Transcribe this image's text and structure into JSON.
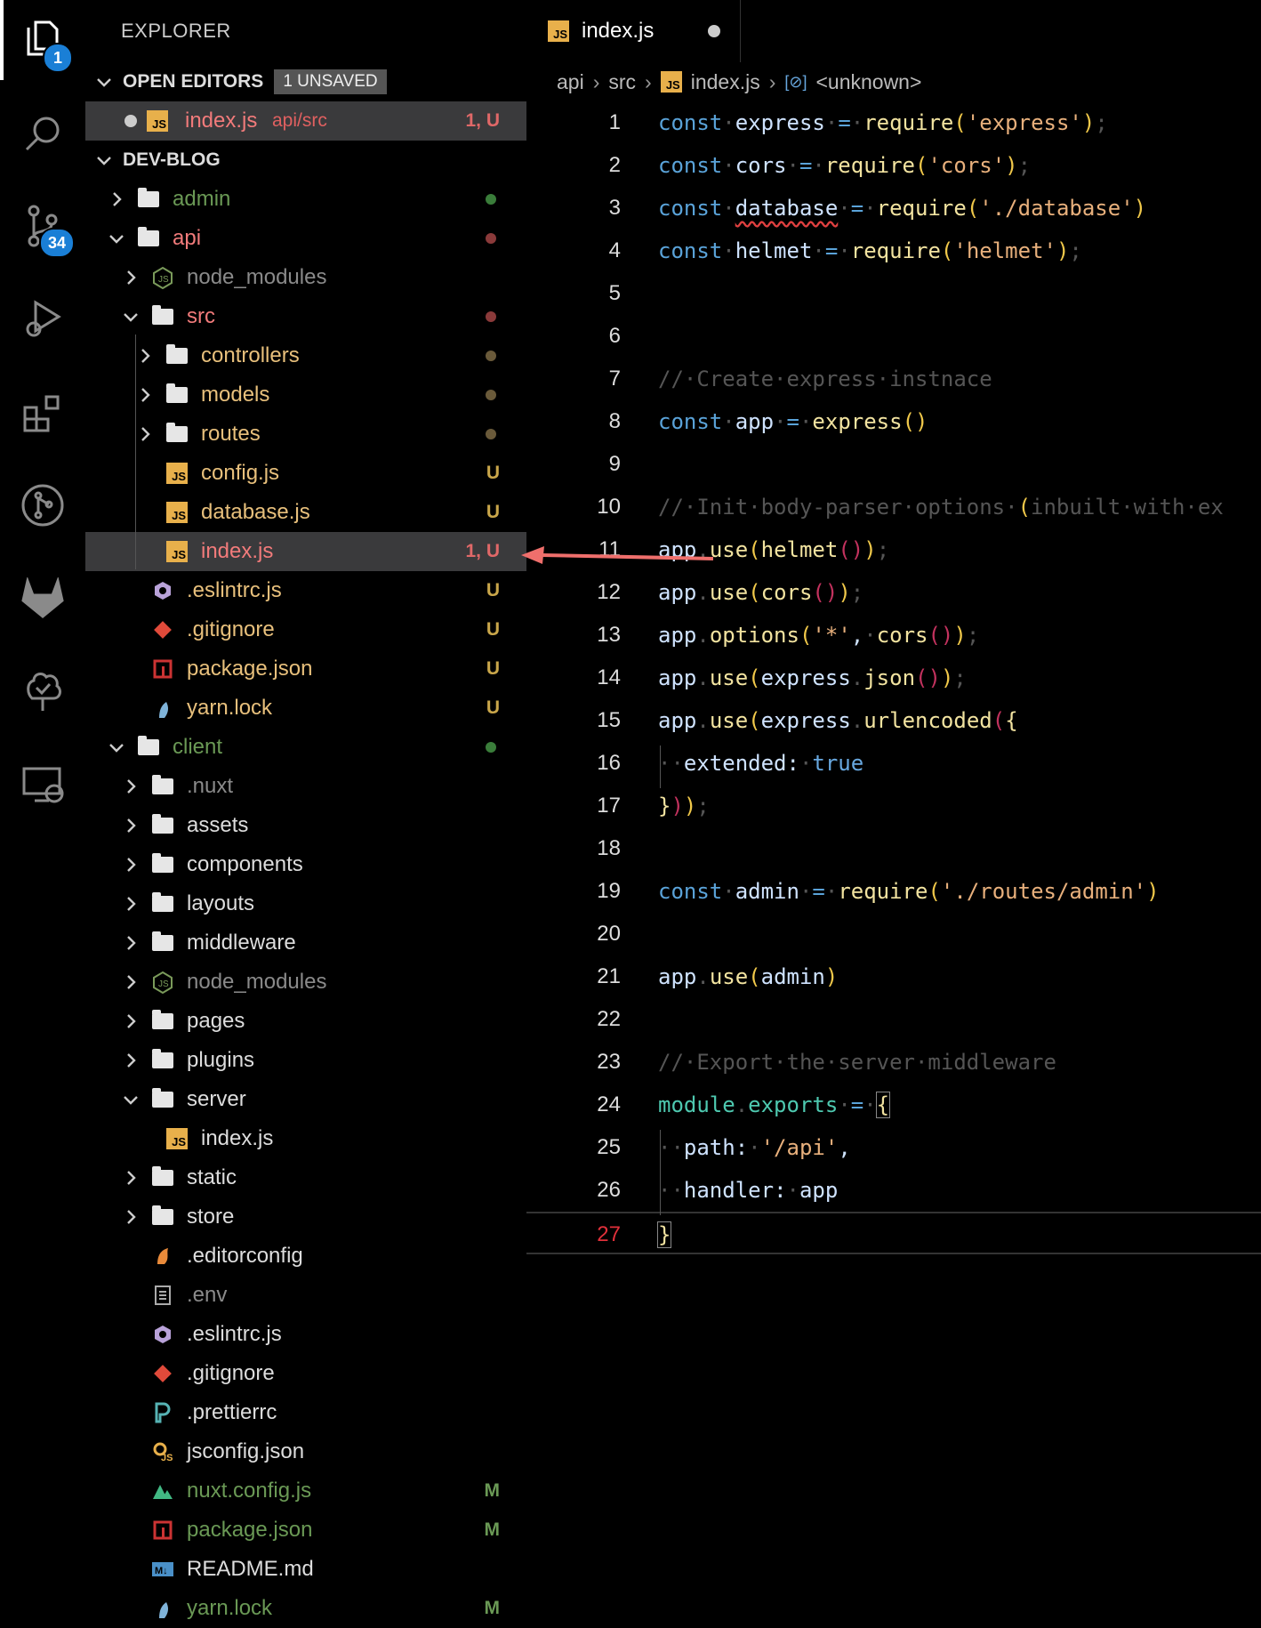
{
  "activity_bar": {
    "explorer_badge": "1",
    "scm_badge": "34",
    "items": [
      "files-icon",
      "search-icon",
      "source-control-icon",
      "run-debug-icon",
      "extensions-icon",
      "git-graph-icon",
      "gitlab-icon",
      "test-icon",
      "remote-explorer-icon"
    ]
  },
  "sidebar": {
    "title": "EXPLORER",
    "open_editors": {
      "label": "OPEN EDITORS",
      "unsaved": "1 UNSAVED",
      "items": [
        {
          "name": "index.js",
          "path": "api/src",
          "status": "1, U"
        }
      ]
    },
    "project": {
      "label": "DEV-BLOG",
      "rows": [
        {
          "label": "admin",
          "status": "",
          "dot": "#3a7d3a"
        },
        {
          "label": "api",
          "status": "",
          "dot": "#8a3a3a"
        },
        {
          "label": "node_modules",
          "status": "",
          "dot": ""
        },
        {
          "label": "src",
          "status": "",
          "dot": "#8a3a3a"
        },
        {
          "label": "controllers",
          "status": "",
          "dot": "#6a5a3a"
        },
        {
          "label": "models",
          "status": "",
          "dot": "#6a5a3a"
        },
        {
          "label": "routes",
          "status": "",
          "dot": "#6a5a3a"
        },
        {
          "label": "config.js",
          "status": "U",
          "dot": ""
        },
        {
          "label": "database.js",
          "status": "U",
          "dot": ""
        },
        {
          "label": "index.js",
          "status": "1, U",
          "dot": ""
        },
        {
          "label": ".eslintrc.js",
          "status": "U",
          "dot": ""
        },
        {
          "label": ".gitignore",
          "status": "U",
          "dot": ""
        },
        {
          "label": "package.json",
          "status": "U",
          "dot": ""
        },
        {
          "label": "yarn.lock",
          "status": "U",
          "dot": ""
        },
        {
          "label": "client",
          "status": "",
          "dot": "#3a7d3a"
        },
        {
          "label": ".nuxt",
          "status": "",
          "dot": ""
        },
        {
          "label": "assets",
          "status": "",
          "dot": ""
        },
        {
          "label": "components",
          "status": "",
          "dot": ""
        },
        {
          "label": "layouts",
          "status": "",
          "dot": ""
        },
        {
          "label": "middleware",
          "status": "",
          "dot": ""
        },
        {
          "label": "node_modules",
          "status": "",
          "dot": ""
        },
        {
          "label": "pages",
          "status": "",
          "dot": ""
        },
        {
          "label": "plugins",
          "status": "",
          "dot": ""
        },
        {
          "label": "server",
          "status": "",
          "dot": ""
        },
        {
          "label": "index.js",
          "status": "",
          "dot": ""
        },
        {
          "label": "static",
          "status": "",
          "dot": ""
        },
        {
          "label": "store",
          "status": "",
          "dot": ""
        },
        {
          "label": ".editorconfig",
          "status": "",
          "dot": ""
        },
        {
          "label": ".env",
          "status": "",
          "dot": ""
        },
        {
          "label": ".eslintrc.js",
          "status": "",
          "dot": ""
        },
        {
          "label": ".gitignore",
          "status": "",
          "dot": ""
        },
        {
          "label": ".prettierrc",
          "status": "",
          "dot": ""
        },
        {
          "label": "jsconfig.json",
          "status": "",
          "dot": ""
        },
        {
          "label": "nuxt.config.js",
          "status": "M",
          "dot": ""
        },
        {
          "label": "package.json",
          "status": "M",
          "dot": ""
        },
        {
          "label": "README.md",
          "status": "",
          "dot": ""
        },
        {
          "label": "yarn.lock",
          "status": "M",
          "dot": ""
        }
      ]
    }
  },
  "editor": {
    "tab": {
      "label": "index.js",
      "modified": true
    },
    "breadcrumb": [
      "api",
      "src",
      "index.js",
      "<unknown>"
    ],
    "current_line": 27,
    "lines": [
      "1",
      "2",
      "3",
      "4",
      "5",
      "6",
      "7",
      "8",
      "9",
      "10",
      "11",
      "12",
      "13",
      "14",
      "15",
      "16",
      "17",
      "18",
      "19",
      "20",
      "21",
      "22",
      "23",
      "24",
      "25",
      "26",
      "27"
    ]
  },
  "colors": {
    "accent": "#1a7fd6",
    "untracked": "#c9a64a",
    "modified": "#6a9955",
    "error": "#e0303a",
    "arrow": "#ef6f6c"
  }
}
